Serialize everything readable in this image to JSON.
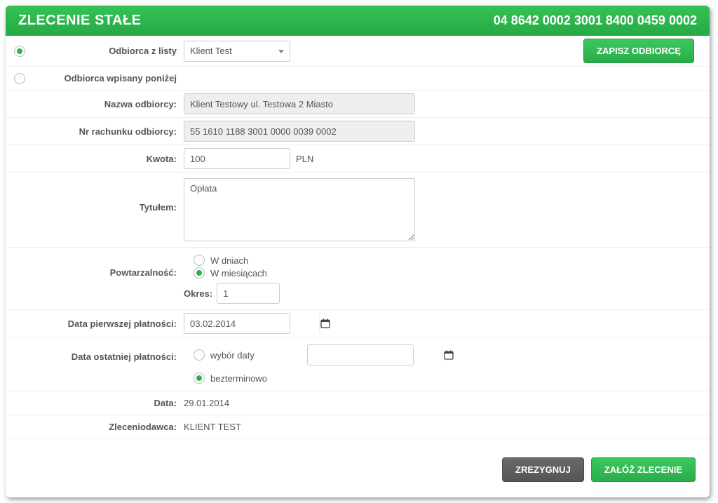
{
  "header": {
    "title": "ZLECENIE STAŁE",
    "account": "04 8642 0002 3001 8400 0459 0002"
  },
  "buttons": {
    "save_recipient": "ZAPISZ ODBIORCĘ",
    "cancel": "ZREZYGNUJ",
    "create": "ZAŁÓŻ ZLECENIE"
  },
  "labels": {
    "recipient_from_list": "Odbiorca z listy",
    "recipient_manual": "Odbiorca wpisany poniżej",
    "recipient_name": "Nazwa odbiorcy:",
    "recipient_account": "Nr rachunku odbiorcy:",
    "amount": "Kwota:",
    "title": "Tytułem:",
    "recurrence": "Powtarzalność:",
    "period": "Okres:",
    "first_payment": "Data pierwszej płatności:",
    "last_payment": "Data ostatniej płatności:",
    "date": "Data:",
    "orderer": "Zleceniodawca:",
    "in_days": "W dniach",
    "in_months": "W miesiącach",
    "pick_date": "wybór daty",
    "indefinitely": "bezterminowo"
  },
  "values": {
    "recipient_select": "Klient Test",
    "recipient_name": "Klient Testowy ul. Testowa 2 Miasto",
    "recipient_account": "55 1610 1188 3001 0000 0039 0002",
    "amount": "100",
    "currency": "PLN",
    "title_text": "Opłata",
    "period_value": "1",
    "first_payment_date": "03.02.2014",
    "last_payment_date": "",
    "date": "29.01.2014",
    "orderer": "KLIENT TEST"
  },
  "radios": {
    "recipient_mode": "from_list",
    "recurrence_unit": "months",
    "last_payment_mode": "indefinitely"
  }
}
